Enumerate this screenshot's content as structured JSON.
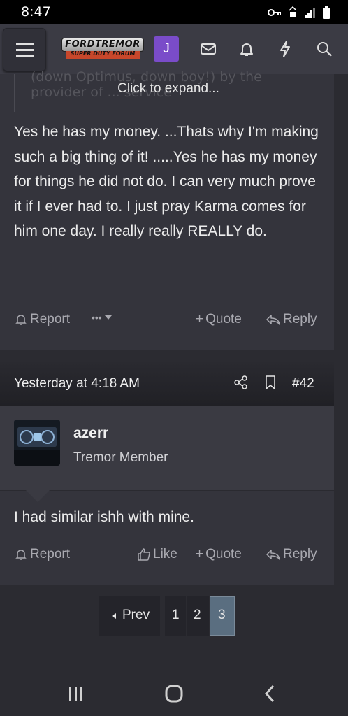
{
  "status": {
    "time": "8:47"
  },
  "header": {
    "logo_top": "FORDTREMOR",
    "logo_bottom": "SUPER DUTY FORUM",
    "avatar_letter": "J",
    "icons": [
      "menu-icon",
      "envelope-icon",
      "bell-icon",
      "bolt-icon",
      "search-icon"
    ]
  },
  "quote": {
    "faded_line_1": "(down Optimus, down boy!) by the",
    "faded_line_2": "provider of ... service",
    "expand_label": "Click to expand..."
  },
  "post1": {
    "body": "Yes he has my money. ...Thats why I'm making such a big thing of it! .....Yes he has my money for things he did not do. I can very much prove it if I ever had to. I just pray Karma comes for him one day. I really really REALLY do.",
    "report": "Report",
    "more": "•••",
    "quote": "Quote",
    "reply": "Reply"
  },
  "post2": {
    "date": "Yesterday at 4:18 AM",
    "post_number": "#42",
    "username": "azerr",
    "user_title": "Tremor Member",
    "body": "I had similar ishh with mine.",
    "report": "Report",
    "like": "Like",
    "quote": "Quote",
    "reply": "Reply"
  },
  "pagination": {
    "prev": "Prev",
    "pages": [
      "1",
      "2",
      "3"
    ],
    "current": "3"
  },
  "colors": {
    "accent": "#7a4cc9",
    "current_page": "#5a6e80",
    "background": "#2b2b31"
  }
}
